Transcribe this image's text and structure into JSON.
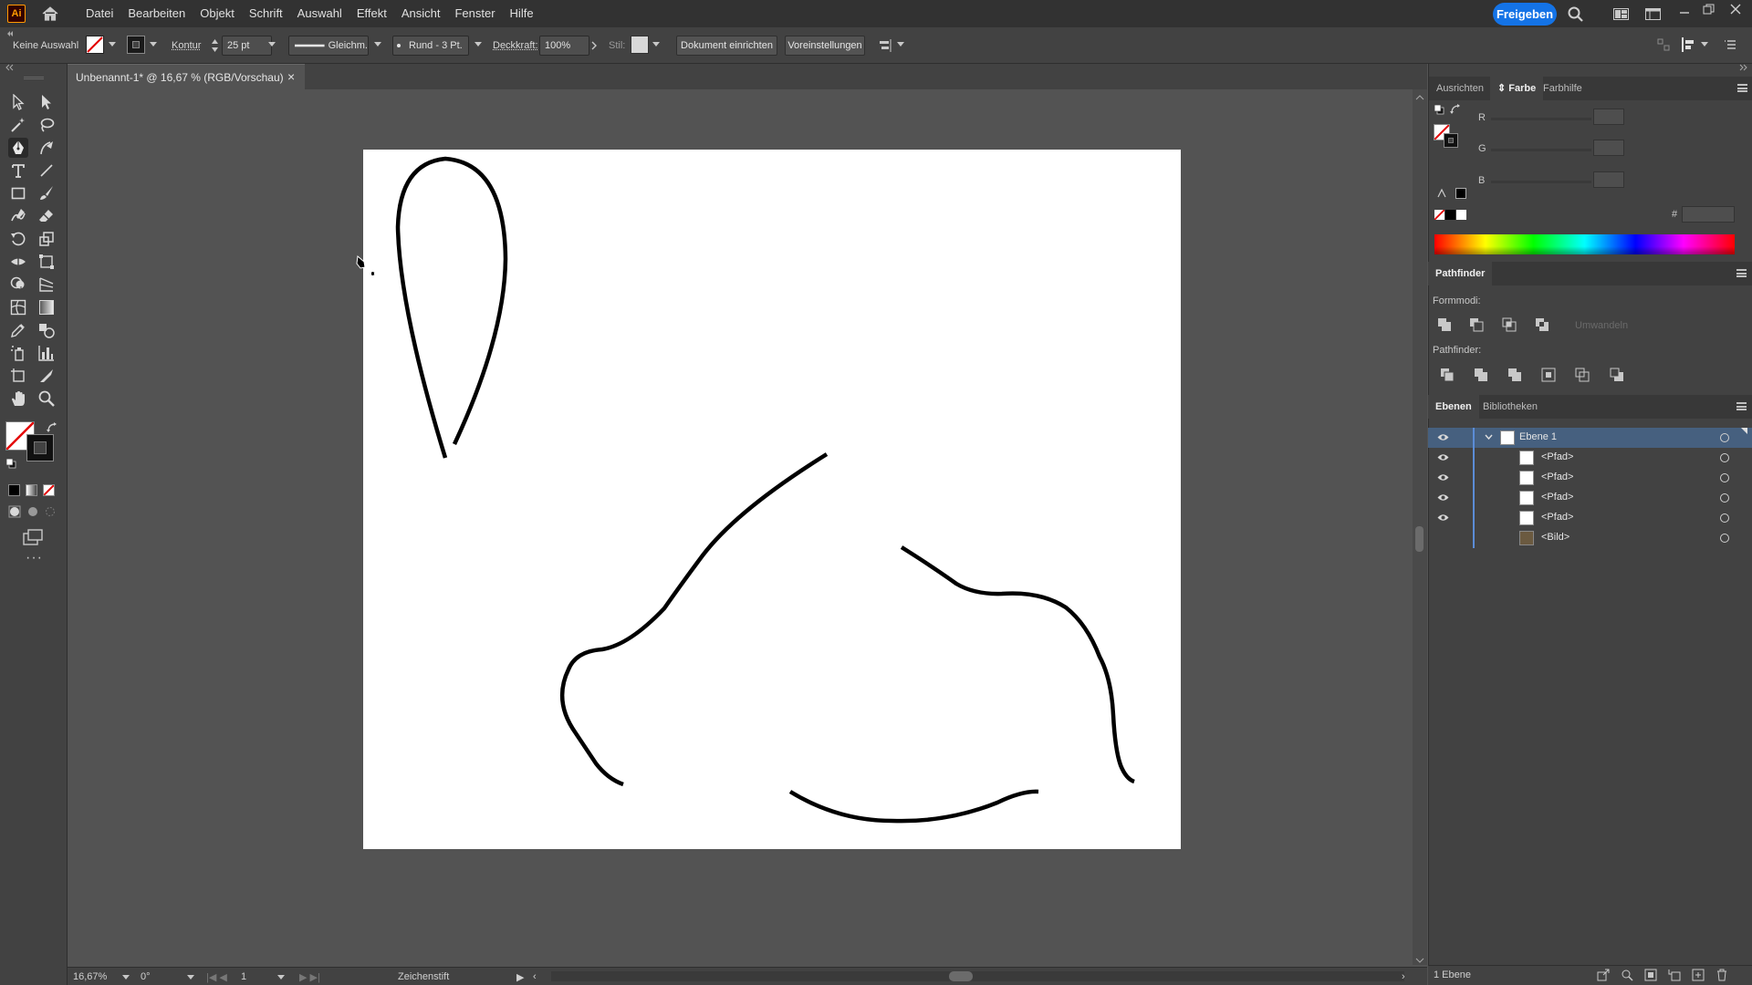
{
  "app": {
    "logo_text": "Ai",
    "menus": [
      "Datei",
      "Bearbeiten",
      "Objekt",
      "Schrift",
      "Auswahl",
      "Effekt",
      "Ansicht",
      "Fenster",
      "Hilfe"
    ],
    "share_label": "Freigeben"
  },
  "controlbar": {
    "selection_state": "Keine Auswahl",
    "stroke_label": "Kontur",
    "stroke_weight": "25 pt",
    "profile_label": "Gleichm.",
    "brush_label": "Rund - 3 Pt.",
    "opacity_label": "Deckkraft:",
    "opacity_value": "100%",
    "style_label": "Stil:",
    "doc_setup_label": "Dokument einrichten",
    "prefs_label": "Voreinstellungen"
  },
  "document": {
    "tab_title": "Unbenannt-1* @ 16,67 % (RGB/Vorschau)",
    "tab_close": "×"
  },
  "statusbar": {
    "zoom": "16,67%",
    "rotation": "0°",
    "artboard_number": "1",
    "current_tool": "Zeichenstift"
  },
  "color_panel": {
    "tabs": [
      "Ausrichten",
      "Farbe",
      "Farbhilfe"
    ],
    "active_tab": "Farbe",
    "channels": [
      "R",
      "G",
      "B"
    ],
    "hex_label": "#"
  },
  "pathfinder": {
    "title": "Pathfinder",
    "shape_modes_label": "Formmodi:",
    "expand_label": "Umwandeln",
    "pathfinders_label": "Pathfinder:"
  },
  "layers": {
    "tabs": [
      "Ebenen",
      "Bibliotheken"
    ],
    "active_tab": "Ebenen",
    "layer_name": "Ebene 1",
    "items": [
      "<Pfad>",
      "<Pfad>",
      "<Pfad>",
      "<Pfad>",
      "<Bild>"
    ],
    "footer_count": "1 Ebene"
  },
  "colors": {
    "accent": "#1473e6",
    "selection_row": "#46607f",
    "layer_color": "#5b8cd6",
    "stroke_color": "#000000"
  }
}
